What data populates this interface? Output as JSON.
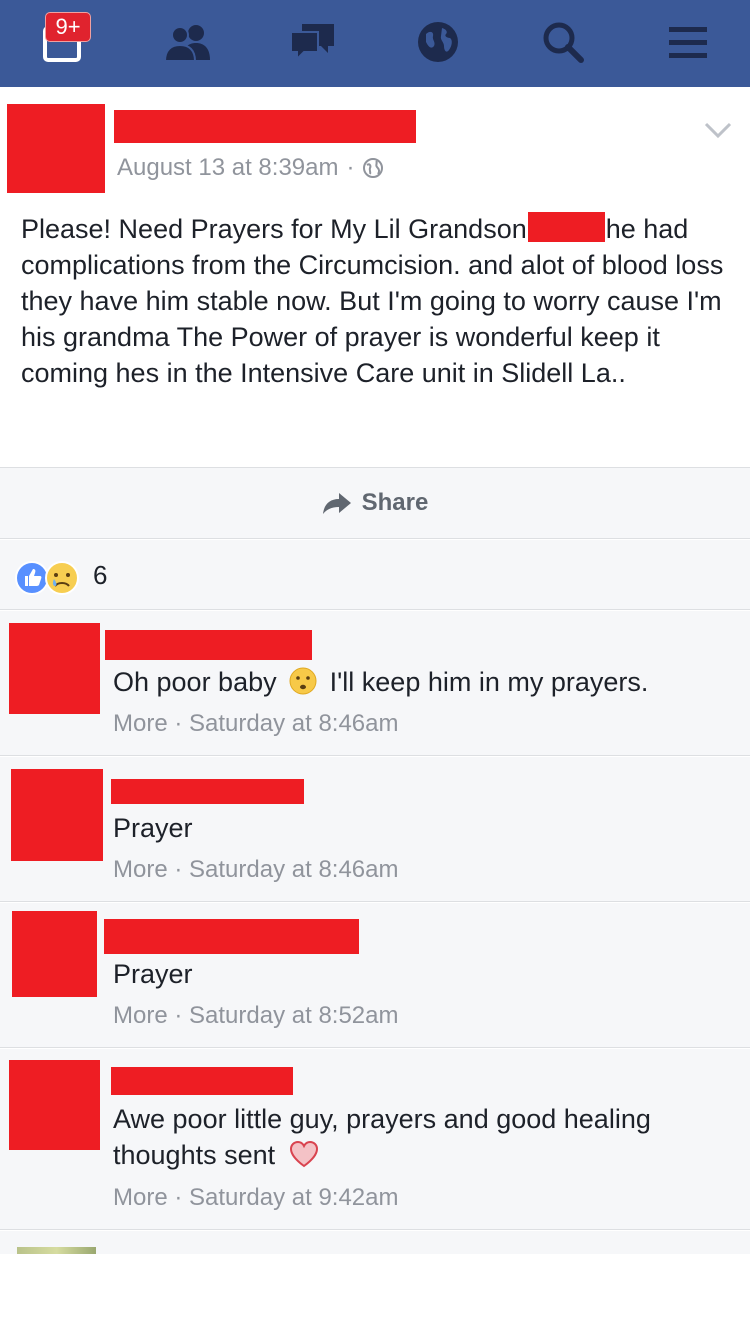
{
  "topbar": {
    "notification_badge": "9+",
    "icons": [
      "notifications-icon",
      "friends-icon",
      "messages-icon",
      "globe-icon",
      "search-icon",
      "menu-icon"
    ],
    "colors": {
      "bar": "#3b5998",
      "badge": "#e0232e"
    }
  },
  "post": {
    "timestamp": "August 13 at 8:39am",
    "separator": "·",
    "text_part1": "Please! Need Prayers for My Lil Grandson",
    "text_part2": "he had complications from the Circumcision. and alot of blood loss they have him stable now. But I'm going to worry cause I'm his grandma The Power of prayer is wonderful keep it coming hes in the Intensive Care unit in Slidell La..",
    "redaction_color": "#ee1d23"
  },
  "share": {
    "label": "Share"
  },
  "reactions": {
    "count": "6",
    "types": [
      "like",
      "sad"
    ]
  },
  "comments": [
    {
      "text_before": "Oh poor baby",
      "text_after": "I'll keep him in my prayers.",
      "more": "More",
      "sep": "·",
      "time": "Saturday at 8:46am"
    },
    {
      "text": "Prayer",
      "more": "More",
      "sep": "·",
      "time": "Saturday at 8:46am"
    },
    {
      "text": "Prayer",
      "more": "More",
      "sep": "·",
      "time": "Saturday at 8:52am"
    },
    {
      "text": "Awe poor little guy, prayers and good healing thoughts sent",
      "more": "More",
      "sep": "·",
      "time": "Saturday at 9:42am"
    }
  ]
}
